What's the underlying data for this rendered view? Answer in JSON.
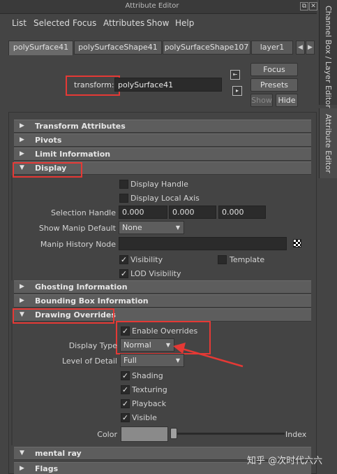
{
  "window": {
    "title": "Attribute Editor"
  },
  "menu": [
    "List",
    "Selected",
    "Focus",
    "Attributes",
    "Show",
    "Help"
  ],
  "tabs": [
    "polySurface41",
    "polySurfaceShape41",
    "polySurfaceShape107",
    "layer1"
  ],
  "side_tabs": [
    "Channel Box / Layer Editor",
    "Attribute Editor"
  ],
  "node": {
    "label": "transform:",
    "value": "polySurface41"
  },
  "buttons": {
    "focus": "Focus",
    "presets": "Presets",
    "show": "Show",
    "hide": "Hide"
  },
  "sections": {
    "transform": "Transform Attributes",
    "pivots": "Pivots",
    "limit": "Limit Information",
    "display": "Display",
    "ghosting": "Ghosting Information",
    "bbox": "Bounding Box Information",
    "drawing": "Drawing Overrides",
    "mental_ray": "mental ray",
    "flags": "Flags"
  },
  "display": {
    "display_handle": "Display Handle",
    "display_local_axis": "Display Local Axis",
    "selection_handle_label": "Selection Handle",
    "selection_handle": [
      "0.000",
      "0.000",
      "0.000"
    ],
    "show_manip_label": "Show Manip Default",
    "show_manip_value": "None",
    "manip_history_label": "Manip History Node",
    "manip_history_value": "",
    "visibility": "Visibility",
    "template": "Template",
    "lod_visibility": "LOD Visibility"
  },
  "overrides": {
    "enable": "Enable Overrides",
    "display_type_label": "Display Type",
    "display_type_value": "Normal",
    "lod_label": "Level of Detail",
    "lod_value": "Full",
    "shading": "Shading",
    "texturing": "Texturing",
    "playback": "Playback",
    "visible": "Visible",
    "color_label": "Color",
    "index_label": "Index"
  },
  "checkmark": "✓",
  "watermark": "知乎 @次时代六六",
  "colors": {
    "highlight": "#e53935",
    "panel": "#444444",
    "header": "#5d5d5d"
  }
}
